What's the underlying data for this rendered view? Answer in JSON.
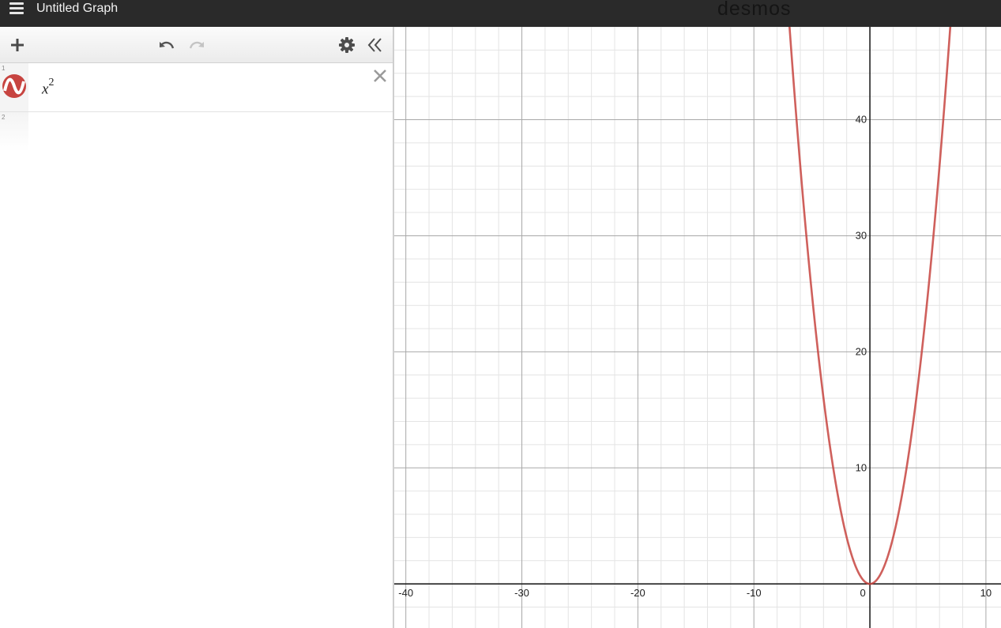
{
  "app": {
    "title": "Untitled Graph",
    "brand": "desmos"
  },
  "toolbar": {
    "add": "add-expression",
    "undo": "undo",
    "redo": "redo",
    "settings": "settings",
    "collapse": "hide-expression-list"
  },
  "expressions": [
    {
      "index": "1",
      "base": "x",
      "exponent": "2",
      "color": "#c74440",
      "icon": "graph-wave-icon"
    },
    {
      "index": "2",
      "base": "",
      "exponent": "",
      "color": "",
      "icon": ""
    }
  ],
  "chart_data": {
    "type": "line",
    "series": [
      {
        "name": "x^2",
        "function": "y = x^2",
        "color": "#c74440"
      }
    ],
    "xlim": [
      -41,
      11.3
    ],
    "ylim": [
      -3.8,
      48
    ],
    "x_ticks": [
      "-40",
      "-30",
      "-20",
      "-10",
      "0",
      "10"
    ],
    "y_ticks": [
      "10",
      "20",
      "30",
      "40"
    ],
    "grid": true
  }
}
